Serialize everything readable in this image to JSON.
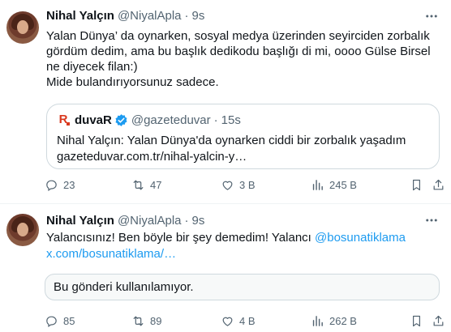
{
  "tweets": [
    {
      "author_name": "Nihal Yalçın",
      "handle": "@NiyalApla",
      "separator": "·",
      "time": "9s",
      "text": "Yalan Dünya’ da oynarken, sosyal medya üzerinden seyirciden zorbalık gördüm dedim, ama bu başlık dedikodu başlığı di mi, oooo Gülse Birsel ne diyecek filan:)\nMide bulandırıyorsunuz sadece.",
      "quote": {
        "name": "duvaR",
        "handle": "@gazeteduvar",
        "separator": "·",
        "time": "15s",
        "text": "Nihal Yalçın: Yalan Dünya'da oynarken ciddi bir zorbalık yaşadım",
        "link": "gazeteduvar.com.tr/nihal-yalcin-y…",
        "verified": true
      },
      "stats": {
        "replies": "23",
        "reposts": "47",
        "likes": "3 B",
        "views": "245 B"
      }
    },
    {
      "author_name": "Nihal Yalçın",
      "handle": "@NiyalApla",
      "separator": "·",
      "time": "9s",
      "text": "Yalancısınız! Ben böyle bir şey demedim! Yalancı ",
      "mention": "@bosunatiklama",
      "link": "x.com/bosunatiklama/…",
      "unavailable": "Bu gönderi kullanılamıyor.",
      "stats": {
        "replies": "85",
        "reposts": "89",
        "likes": "4 B",
        "views": "262 B"
      }
    }
  ],
  "icons": {
    "more": "more-horizontal-icon",
    "reply": "reply-icon",
    "repost": "repost-icon",
    "like": "heart-icon",
    "views": "views-chart-icon",
    "bookmark": "bookmark-icon",
    "share": "share-icon",
    "verified": "verified-badge-icon"
  },
  "colors": {
    "link": "#1d9bf0",
    "muted": "#536471",
    "verified": "#1d9bf0",
    "brand": "#d9381e"
  }
}
